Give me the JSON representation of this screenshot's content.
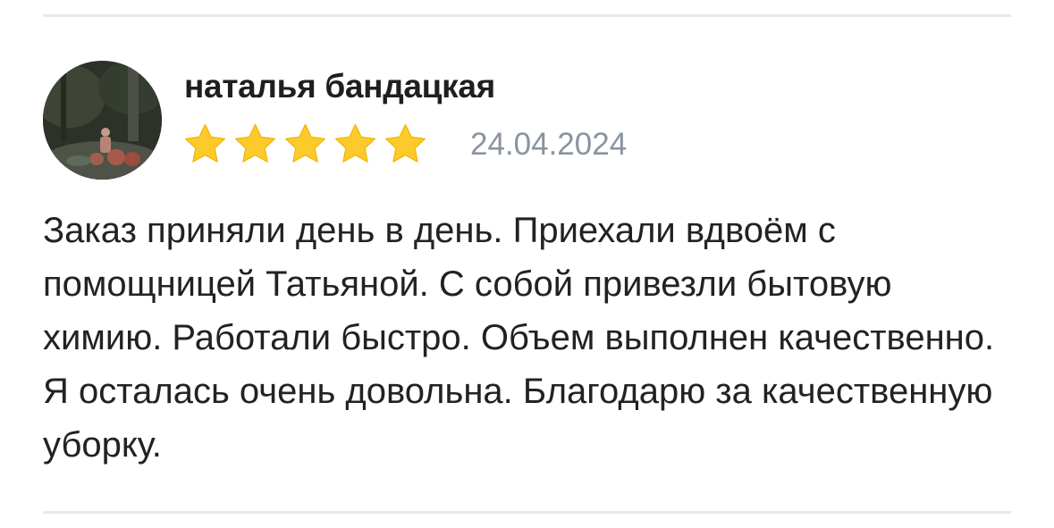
{
  "review": {
    "author_name": "наталья бандацкая",
    "rating": 5,
    "rating_max": 5,
    "date": "24.04.2024",
    "text": "Заказ приняли день в день. Приехали вдвоём с помощницей Татьяной. С собой привезли бытовую химию. Работали быстро. Объем выполнен качественно. Я осталась очень довольна. Благодарю за качественную уборку.",
    "avatar_icon": "user-photo"
  },
  "colors": {
    "star": "#fccb2b",
    "date": "#8b93a0",
    "divider": "#e6e9ee",
    "text": "#222222"
  }
}
